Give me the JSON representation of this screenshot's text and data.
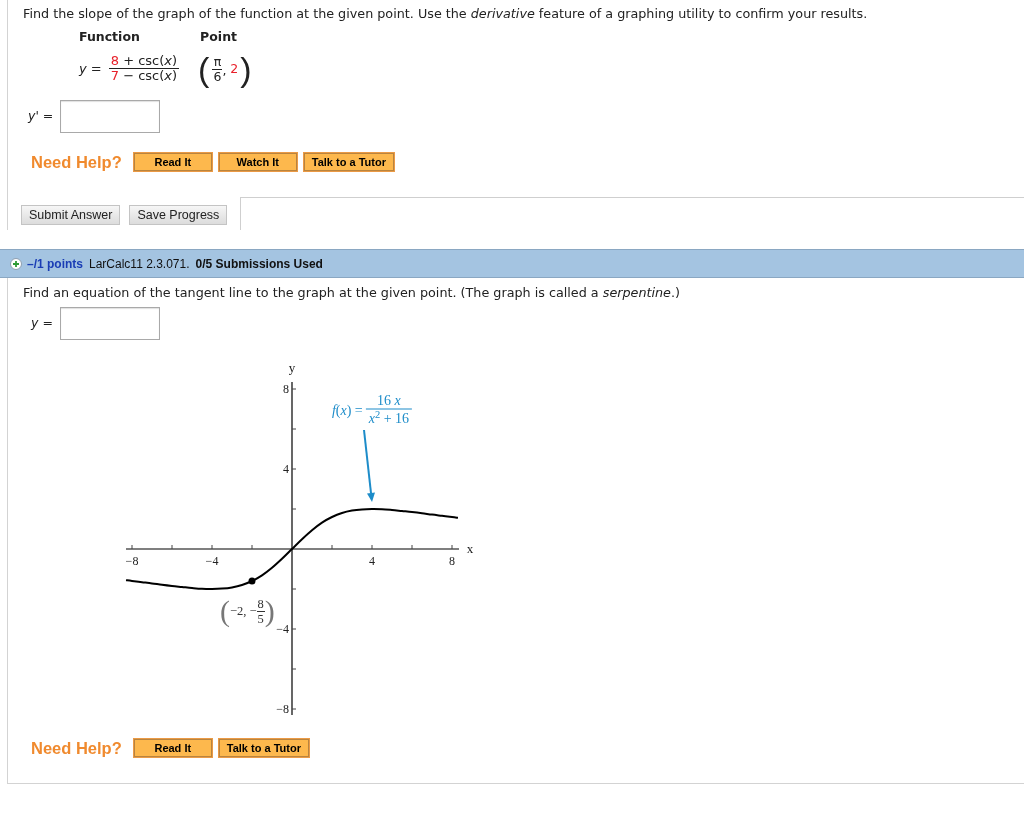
{
  "question_1": {
    "prompt": "Find the slope of the graph of the function at the given point. Use the *derivative* feature of a graphing utility to confirm your results.",
    "table": {
      "headers": [
        "Function",
        "Point"
      ],
      "function": {
        "lhs": "*y* =",
        "numerator": [
          {
            "text": "8",
            "highlighted": true
          },
          {
            "text": " + csc(*x*)",
            "highlighted": false
          }
        ],
        "denominator": [
          {
            "text": "7",
            "highlighted": true
          },
          {
            "text": " − csc(*x*)",
            "highlighted": false
          }
        ]
      },
      "point": {
        "open": "(",
        "numerator": "π",
        "denominator": "6",
        "separator": ",",
        "value": {
          "text": "2",
          "highlighted": true
        },
        "close": ")"
      }
    },
    "answer": {
      "label": "*y'* ="
    },
    "help": {
      "label": "Need Help?",
      "buttons": [
        "Read It",
        "Watch It",
        "Talk to a Tutor"
      ]
    },
    "actions": [
      "Submit Answer",
      "Save Progress"
    ]
  },
  "question_2": {
    "header": {
      "points": "–/1 points",
      "source": "LarCalc11 2.3.071.",
      "submissions": "0/5 Submissions Used"
    },
    "prompt": "Find an equation of the tangent line to the graph at the given point. (The graph is called a *serpentine*.)",
    "answer": {
      "label": "*y* ="
    },
    "graph": {
      "chart_data": {
        "type": "line",
        "xlabel": "x",
        "ylabel": "y",
        "x": [
          -8.3,
          -8,
          -7.5,
          -7,
          -6.5,
          -6,
          -5.5,
          -5,
          -4.5,
          -4,
          -3.5,
          -3,
          -2.5,
          -2,
          -1.5,
          -1,
          -0.5,
          0,
          0.5,
          1,
          1.5,
          2,
          2.5,
          3,
          3.5,
          4,
          4.5,
          5,
          5.5,
          6,
          6.5,
          7,
          7.5,
          8,
          8.3
        ],
        "series": [
          {
            "color": "#000000",
            "values": [
              -1.56,
              -1.6,
              -1.66,
              -1.72,
              -1.79,
              -1.85,
              -1.9,
              -1.95,
              -1.99,
              -2,
              -1.98,
              -1.92,
              -1.8,
              -1.6,
              -1.32,
              -0.94,
              -0.49,
              0,
              0.49,
              0.94,
              1.32,
              1.6,
              1.8,
              1.92,
              1.98,
              2,
              1.99,
              1.95,
              1.9,
              1.85,
              1.79,
              1.72,
              1.66,
              1.6,
              1.56
            ]
          },
          {
            "color": "#000000",
            "marker": "circle",
            "values": [
              null,
              null,
              null,
              null,
              null,
              null,
              null,
              null,
              null,
              null,
              null,
              null,
              null,
              -1.6,
              null,
              null,
              null,
              null,
              null,
              null,
              null,
              null,
              null,
              null,
              null,
              null,
              null,
              null,
              null,
              null,
              null,
              null,
              null,
              null,
              null
            ]
          }
        ],
        "xlim": [
          -8.3,
          8.35
        ],
        "ylim": [
          -8.3,
          8.35
        ],
        "xticks": [
          {
            "value": -8,
            "label": "−8"
          },
          {
            "value": -4,
            "label": "−4"
          },
          4,
          8
        ],
        "yticks": [
          {
            "value": -8,
            "label": "−8"
          },
          {
            "value": -4,
            "label": "−4"
          },
          4,
          8
        ]
      },
      "function_label": {
        "lhs": "*f*(*x*) =",
        "numerator": "16 *x*",
        "denominator": "*x*$^{2}$ + 16"
      },
      "point_label": {
        "open": "(",
        "prefix": "−2, −",
        "numerator": "8",
        "denominator": "5",
        "close": ")"
      }
    },
    "help": {
      "label": "Need Help?",
      "buttons": [
        "Read It",
        "Talk to a Tutor"
      ]
    }
  }
}
